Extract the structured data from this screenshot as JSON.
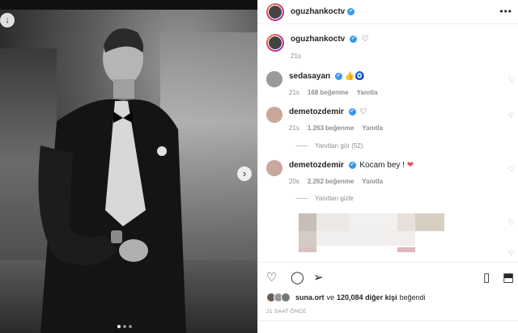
{
  "post": {
    "author": "oguzhankoctv",
    "verified_mark": "✔",
    "more_icon": "•••"
  },
  "caption": {
    "username": "oguzhankoctv",
    "time": "21s"
  },
  "comments": [
    {
      "username": "sedasayan",
      "text": "👍🧿",
      "time": "21s",
      "likes": "168 beğenme",
      "reply": "Yanıtla"
    },
    {
      "username": "demetozdemir",
      "text": "♡",
      "time": "21s",
      "likes": "1.263 beğenme",
      "reply": "Yanıtla",
      "thread": "Yanıtları gör (52)"
    },
    {
      "username": "demetozdemir",
      "text": "Kocam bey !",
      "heart": "❤",
      "time": "20s",
      "likes": "2.262 beğenme",
      "reply": "Yanıtla",
      "thread": "Yanıtları gizle"
    }
  ],
  "liked_by": {
    "user": "suna.ort",
    "connector": "ve",
    "count": "120,084 diğer kişi",
    "suffix": "beğendi"
  },
  "timestamp": "21 SAAT ÖNCE",
  "icons": {
    "download": "download-icon",
    "next": "chevron-right-icon",
    "like": "heart-icon",
    "comment": "comment-icon",
    "share": "send-icon",
    "save": "bookmark-icon"
  },
  "colors": {
    "verified": "#3897f0",
    "heart_red": "#ed4956"
  }
}
